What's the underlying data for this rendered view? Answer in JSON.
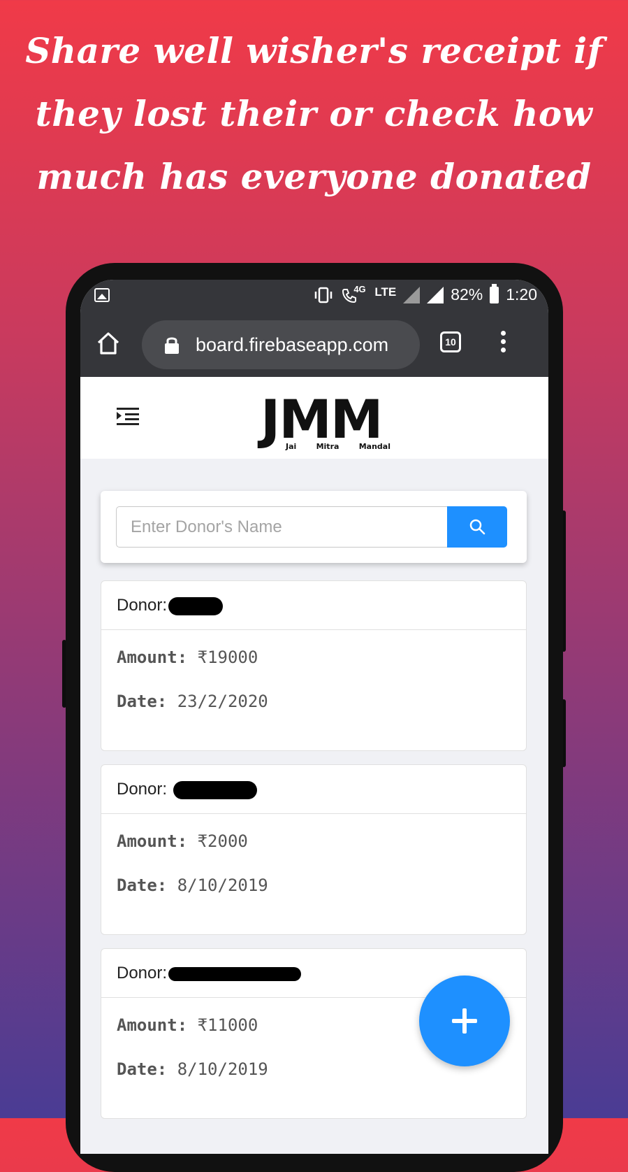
{
  "headline": "Share well wisher's receipt if they lost their or check how much has everyone donated",
  "status": {
    "network": "4G",
    "lte": "LTE",
    "battery": "82%",
    "time": "1:20"
  },
  "browser": {
    "url": "board.firebaseapp.com",
    "tab_count": "10"
  },
  "logo": {
    "letters": "JMM",
    "words": [
      "Jai",
      "Mitra",
      "Mandal"
    ]
  },
  "search": {
    "placeholder": "Enter Donor's Name"
  },
  "donations": [
    {
      "donor_label": "Donor:",
      "amount_label": "Amount:",
      "amount": "₹19000",
      "date_label": "Date:",
      "date": "23/2/2020"
    },
    {
      "donor_label": "Donor:",
      "amount_label": "Amount:",
      "amount": "₹2000",
      "date_label": "Date:",
      "date": "8/10/2019"
    },
    {
      "donor_label": "Donor:",
      "amount_label": "Amount:",
      "amount": "₹11000",
      "date_label": "Date:",
      "date": "8/10/2019"
    }
  ],
  "colors": {
    "accent": "#1e90ff",
    "browser_chrome": "#35363a"
  }
}
